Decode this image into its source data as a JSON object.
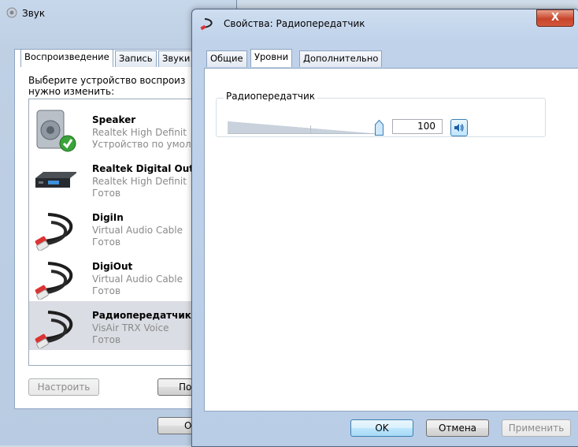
{
  "sound_window": {
    "title": "Звук",
    "tabs": [
      "Воспроизведение",
      "Запись",
      "Звуки"
    ],
    "instruction_line1": "Выберите устройство воспроиз",
    "instruction_line2": "нужно изменить:",
    "devices": [
      {
        "name": "Speaker",
        "driver": "Realtek High Definit",
        "status": "Устройство по умол",
        "icon": "speaker-icon",
        "default": true
      },
      {
        "name": "Realtek Digital Outp",
        "driver": "Realtek High Definit",
        "status": "Готов",
        "icon": "digital-output-icon"
      },
      {
        "name": "DigiIn",
        "driver": "Virtual Audio Cable",
        "status": "Готов",
        "icon": "audio-cable-icon"
      },
      {
        "name": "DigiOut",
        "driver": "Virtual Audio Cable",
        "status": "Готов",
        "icon": "audio-cable-icon"
      },
      {
        "name": "Радиопередатчик",
        "driver": "VisAir TRX Voice",
        "status": "Готов",
        "icon": "audio-cable-icon",
        "selected": true
      }
    ],
    "configure_button": "Настроить",
    "partial_button": "По",
    "partial_ok_button": "О"
  },
  "properties_window": {
    "title": "Свойства: Радиопередатчик",
    "close_label": "X",
    "tabs": [
      "Общие",
      "Уровни",
      "Дополнительно"
    ],
    "active_tab": "Уровни",
    "group_label": "Радиопередатчик",
    "volume_value": "100",
    "volume_level_fraction": 1.0,
    "buttons": {
      "ok": "OK",
      "cancel": "Отмена",
      "apply": "Применить"
    }
  }
}
